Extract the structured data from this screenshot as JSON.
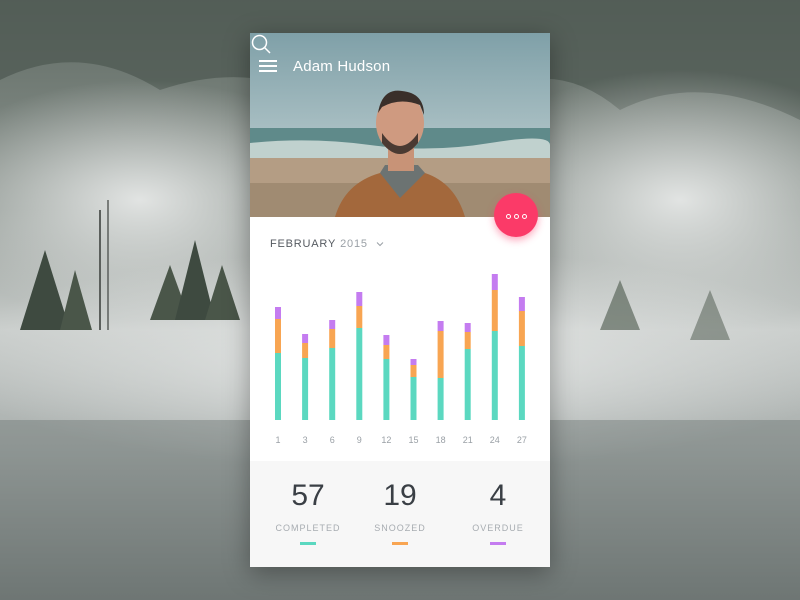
{
  "header": {
    "user_name": "Adam Hudson"
  },
  "icons": {
    "menu": "hamburger-menu-icon",
    "search": "search-icon",
    "more": "more-options-icon",
    "dropdown": "chevron-down-icon"
  },
  "calendar": {
    "month": "FEBRUARY",
    "year": "2015"
  },
  "colors": {
    "completed": "#5bd8c0",
    "snoozed": "#f8a552",
    "overdue": "#c47cf0",
    "accent": "#fb3a68"
  },
  "chart_data": {
    "type": "bar",
    "stacked": true,
    "categories": [
      "1",
      "3",
      "6",
      "9",
      "12",
      "15",
      "18",
      "21",
      "24",
      "27"
    ],
    "series": [
      {
        "name": "COMPLETED",
        "values": [
          67,
          62,
          72,
          92,
          61,
          43,
          42,
          71,
          89,
          74
        ]
      },
      {
        "name": "SNOOZED",
        "values": [
          34,
          15,
          19,
          22,
          14,
          12,
          47,
          17,
          41,
          35
        ]
      },
      {
        "name": "OVERDUE",
        "values": [
          12,
          9,
          9,
          14,
          10,
          6,
          10,
          9,
          16,
          14
        ]
      }
    ],
    "ylim": [
      0,
      150
    ],
    "grid": false,
    "legend": "none"
  },
  "stats": [
    {
      "value": "57",
      "label": "COMPLETED"
    },
    {
      "value": "19",
      "label": "SNOOZED"
    },
    {
      "value": "4",
      "label": "OVERDUE"
    }
  ]
}
